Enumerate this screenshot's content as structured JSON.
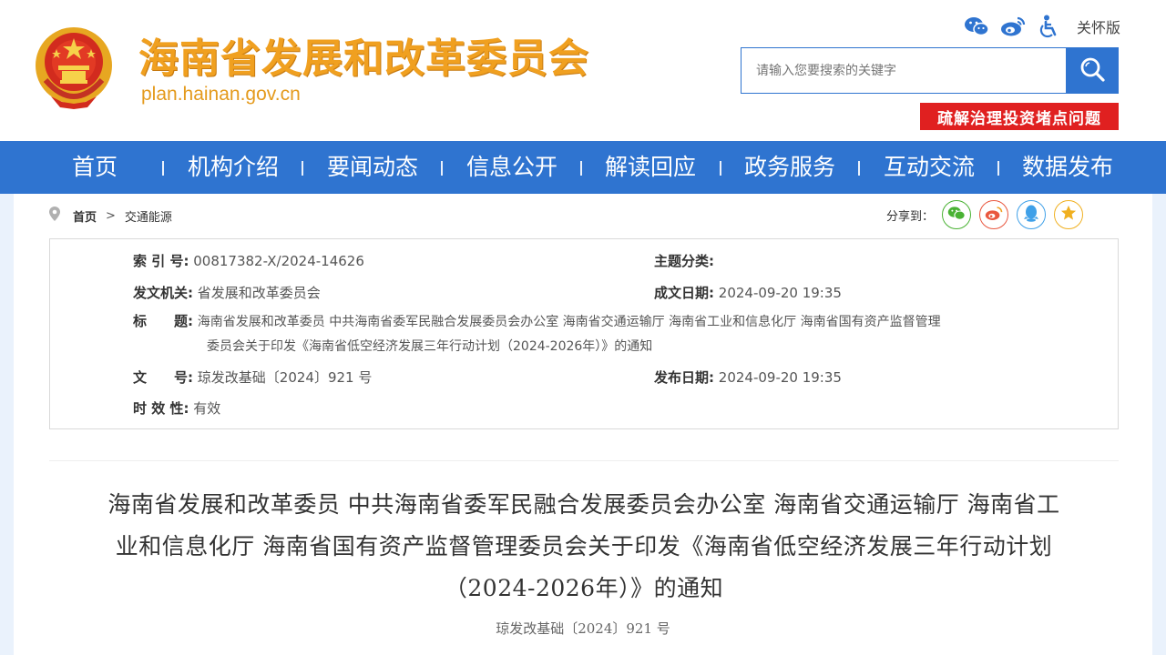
{
  "header": {
    "site_title": "海南省发展和改革委员会",
    "site_domain": "plan.hainan.gov.cn",
    "care_label": "关怀版",
    "search_placeholder": "请输入您要搜索的关键字",
    "banner": "疏解治理投资堵点问题",
    "icons": [
      "wechat-icon",
      "weibo-icon",
      "accessibility-icon",
      "search-icon"
    ]
  },
  "nav": {
    "items": [
      "首页",
      "机构介绍",
      "要闻动态",
      "信息公开",
      "解读回应",
      "政务服务",
      "互动交流",
      "数据发布"
    ]
  },
  "breadcrumb": {
    "home": "首页",
    "separator": ">",
    "current": "交通能源"
  },
  "share": {
    "label": "分享到：",
    "targets": [
      "wechat",
      "weibo",
      "qq",
      "favorite"
    ]
  },
  "info": {
    "index_label": "索 引 号:",
    "index_value": "00817382-X/2024-14626",
    "topic_label": "主题分类:",
    "topic_value": "",
    "issuer_label": "发文机关:",
    "issuer_value": "省发展和改革委员会",
    "created_label": "成文日期:",
    "created_value": "2024-09-20 19:35",
    "title_label": "标　　题:",
    "title_line1": "海南省发展和改革委员 中共海南省委军民融合发展委员会办公室 海南省交通运输厅 海南省工业和信息化厅 海南省国有资产监督管理",
    "title_line2": "委员会关于印发《海南省低空经济发展三年行动计划（2024-2026年）》的通知",
    "docno_label": "文　　号:",
    "docno_value": "琼发改基础〔2024〕921 号",
    "published_label": "发布日期:",
    "published_value": "2024-09-20 19:35",
    "validity_label": "时 效 性:",
    "validity_value": "有效"
  },
  "article": {
    "title_line1": "海南省发展和改革委员 中共海南省委军民融合发展委员会办公室 海南省交通运输厅 海南省工",
    "title_line2": "业和信息化厅 海南省国有资产监督管理委员会关于印发《海南省低空经济发展三年行动计划",
    "title_line3": "（2024-2026年）》的通知",
    "doc_number": "琼发改基础〔2024〕921 号"
  },
  "colors": {
    "nav_blue": "#2f74d0",
    "title_orange": "#f0a020",
    "banner_red": "#e02020",
    "side_bg": "#eaf2fc"
  }
}
